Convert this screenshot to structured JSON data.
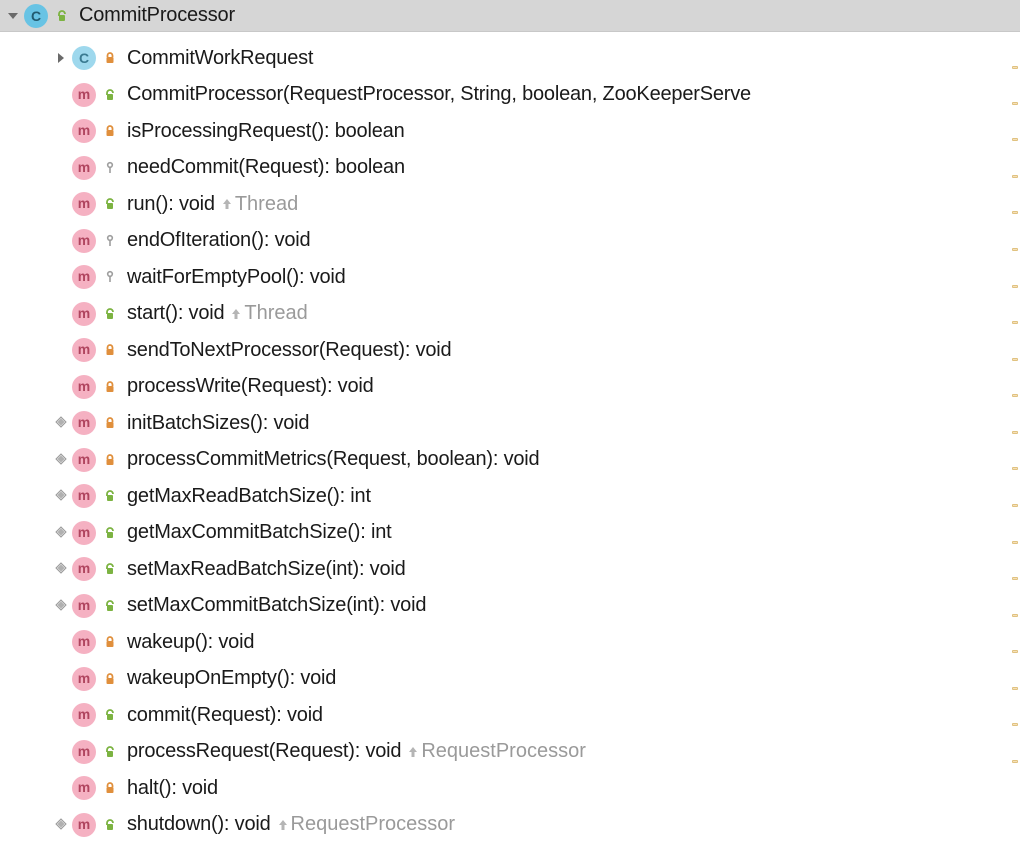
{
  "header": {
    "type_letter": "C",
    "visibility": "public",
    "label": "CommitProcessor"
  },
  "members": [
    {
      "expander": true,
      "type": "class",
      "type_letter": "C",
      "visibility": "private",
      "label": "CommitWorkRequest",
      "inherit": null,
      "gutter": false
    },
    {
      "expander": false,
      "type": "method",
      "type_letter": "m",
      "visibility": "public",
      "label": "CommitProcessor(RequestProcessor, String, boolean, ZooKeeperServe",
      "inherit": null,
      "gutter": false
    },
    {
      "expander": false,
      "type": "method",
      "type_letter": "m",
      "visibility": "private",
      "label": "isProcessingRequest(): boolean",
      "inherit": null,
      "gutter": false
    },
    {
      "expander": false,
      "type": "method",
      "type_letter": "m",
      "visibility": "package",
      "label": "needCommit(Request): boolean",
      "inherit": null,
      "gutter": false
    },
    {
      "expander": false,
      "type": "method",
      "type_letter": "m",
      "visibility": "public",
      "label": "run(): void",
      "inherit": "Thread",
      "gutter": false
    },
    {
      "expander": false,
      "type": "method",
      "type_letter": "m",
      "visibility": "package",
      "label": "endOfIteration(): void",
      "inherit": null,
      "gutter": false
    },
    {
      "expander": false,
      "type": "method",
      "type_letter": "m",
      "visibility": "package",
      "label": "waitForEmptyPool(): void",
      "inherit": null,
      "gutter": false
    },
    {
      "expander": false,
      "type": "method",
      "type_letter": "m",
      "visibility": "public",
      "label": "start(): void",
      "inherit": "Thread",
      "gutter": false
    },
    {
      "expander": false,
      "type": "method",
      "type_letter": "m",
      "visibility": "private",
      "label": "sendToNextProcessor(Request): void",
      "inherit": null,
      "gutter": false
    },
    {
      "expander": false,
      "type": "method",
      "type_letter": "m",
      "visibility": "private",
      "label": "processWrite(Request): void",
      "inherit": null,
      "gutter": false
    },
    {
      "expander": false,
      "type": "method",
      "type_letter": "m",
      "visibility": "private",
      "label": "initBatchSizes(): void",
      "inherit": null,
      "gutter": true
    },
    {
      "expander": false,
      "type": "method",
      "type_letter": "m",
      "visibility": "private",
      "label": "processCommitMetrics(Request, boolean): void",
      "inherit": null,
      "gutter": true
    },
    {
      "expander": false,
      "type": "method",
      "type_letter": "m",
      "visibility": "public",
      "label": "getMaxReadBatchSize(): int",
      "inherit": null,
      "gutter": true
    },
    {
      "expander": false,
      "type": "method",
      "type_letter": "m",
      "visibility": "public",
      "label": "getMaxCommitBatchSize(): int",
      "inherit": null,
      "gutter": true
    },
    {
      "expander": false,
      "type": "method",
      "type_letter": "m",
      "visibility": "public",
      "label": "setMaxReadBatchSize(int): void",
      "inherit": null,
      "gutter": true
    },
    {
      "expander": false,
      "type": "method",
      "type_letter": "m",
      "visibility": "public",
      "label": "setMaxCommitBatchSize(int): void",
      "inherit": null,
      "gutter": true
    },
    {
      "expander": false,
      "type": "method",
      "type_letter": "m",
      "visibility": "private",
      "label": "wakeup(): void",
      "inherit": null,
      "gutter": false
    },
    {
      "expander": false,
      "type": "method",
      "type_letter": "m",
      "visibility": "private",
      "label": "wakeupOnEmpty(): void",
      "inherit": null,
      "gutter": false
    },
    {
      "expander": false,
      "type": "method",
      "type_letter": "m",
      "visibility": "public",
      "label": "commit(Request): void",
      "inherit": null,
      "gutter": false
    },
    {
      "expander": false,
      "type": "method",
      "type_letter": "m",
      "visibility": "public",
      "label": "processRequest(Request): void",
      "inherit": "RequestProcessor",
      "gutter": false
    },
    {
      "expander": false,
      "type": "method",
      "type_letter": "m",
      "visibility": "private",
      "label": "halt(): void",
      "inherit": null,
      "gutter": false
    },
    {
      "expander": false,
      "type": "method",
      "type_letter": "m",
      "visibility": "public",
      "label": "shutdown(): void",
      "inherit": "RequestProcessor",
      "gutter": true
    }
  ]
}
